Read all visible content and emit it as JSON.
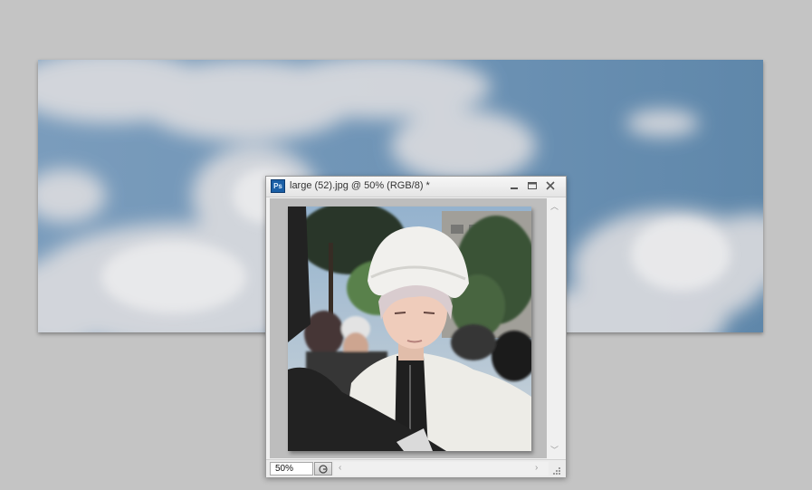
{
  "document_window": {
    "title": "large (52).jpg @ 50% (RGB/8) *",
    "app_icon_text": "Ps",
    "zoom_value": "50%"
  },
  "colors": {
    "workspace_bg": "#c4c4c4",
    "sky": "#6c92b4",
    "window_chrome": "#f0f0f0",
    "app_icon": "#1b5fa6"
  },
  "icons": {
    "app": "photoshop-icon",
    "minimize": "minimize-icon",
    "maximize": "maximize-icon",
    "close": "close-icon",
    "scroll_up": "chevron-up-icon",
    "scroll_down": "chevron-down-icon",
    "scroll_left": "chevron-left-icon",
    "scroll_right": "chevron-right-icon",
    "status_menu": "status-menu-icon",
    "resize": "resize-grip-icon"
  }
}
